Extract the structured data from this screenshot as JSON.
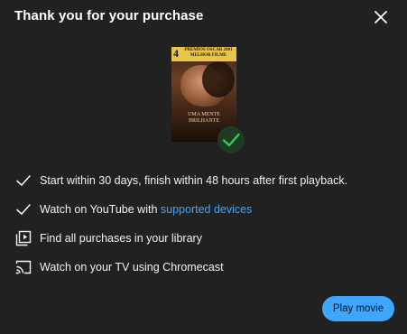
{
  "dialog": {
    "title": "Thank you for your purchase",
    "close_icon": "close-icon"
  },
  "poster": {
    "banner_number": "4",
    "banner_text": "PRÉMIOS OSCAR 2001 MELHOR FILME",
    "movie_title": "UMA MENTE BRILHANTE",
    "badge_icon": "check-icon"
  },
  "features": [
    {
      "icon": "check-icon",
      "text": "Start within 30 days, finish within 48 hours after first playback."
    },
    {
      "icon": "check-icon",
      "text": "Watch on YouTube with ",
      "link": "supported devices"
    },
    {
      "icon": "library-icon",
      "text": "Find all purchases in your library"
    },
    {
      "icon": "cast-icon",
      "text": "Watch on your TV using Chromecast"
    }
  ],
  "actions": {
    "play_label": "Play movie"
  },
  "colors": {
    "background": "#212121",
    "accent": "#3ea6ff",
    "success": "#34c759"
  }
}
